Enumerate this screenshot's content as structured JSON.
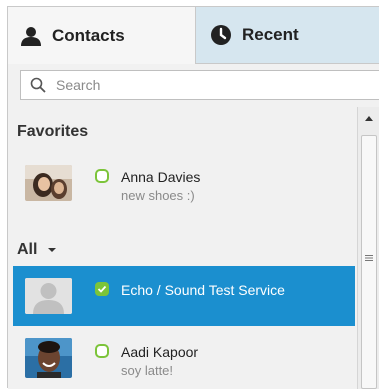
{
  "tabs": {
    "contacts_label": "Contacts",
    "recent_label": "Recent",
    "active": "contacts"
  },
  "search": {
    "placeholder": "Search",
    "value": ""
  },
  "sections": {
    "favorites_label": "Favorites",
    "all_label": "All"
  },
  "contacts": {
    "anna": {
      "name": "Anna Davies",
      "mood": "new shoes :)",
      "status": "online"
    },
    "echo": {
      "name": "Echo / Sound Test Service",
      "mood": "",
      "status": "online",
      "selected": true
    },
    "aadi": {
      "name": "Aadi Kapoor",
      "mood": "soy latte!",
      "status": "online"
    }
  },
  "colors": {
    "selection": "#1b8fcf",
    "status_online": "#7cc43a",
    "recent_tab_bg": "#d6e6ef"
  },
  "icons": [
    "contacts-person-icon",
    "clock-icon",
    "search-icon",
    "status-online-icon",
    "chevron-down-icon",
    "scroll-up-arrow-icon",
    "scroll-grip-icon"
  ]
}
